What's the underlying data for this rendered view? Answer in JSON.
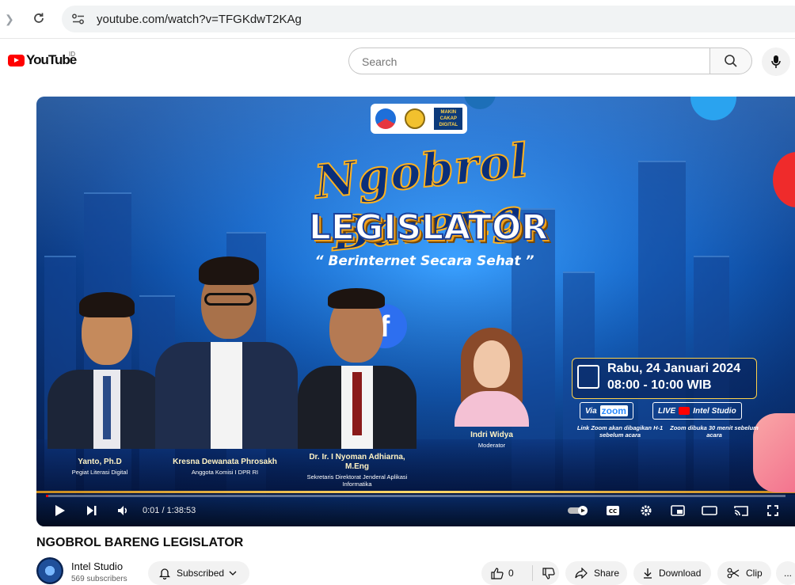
{
  "browser": {
    "url": "youtube.com/watch?v=TFGKdwT2KAg"
  },
  "masthead": {
    "logo_text": "YouTube",
    "country_code": "ID",
    "search_placeholder": "Search"
  },
  "video": {
    "thumbnail": {
      "logos": [
        "KOMINFO",
        "DPR",
        "MAKIN CAKAP DIGITAL"
      ],
      "title_script": "Ngobrol Bareng",
      "title_main": "LEGISLATOR",
      "tagline": "“ Berinternet Secara Sehat ”",
      "speakers": [
        {
          "name": "Yanto, Ph.D",
          "role": "Pegiat Literasi Digital"
        },
        {
          "name": "Kresna Dewanata Phrosakh",
          "role": "Anggota Komisi I DPR RI"
        },
        {
          "name": "Dr. Ir. I Nyoman Adhiarna, M.Eng",
          "role": "Sekretaris Direktorat Jenderal Aplikasi Informatika"
        },
        {
          "name": "Indri Widya",
          "role": "Moderator"
        }
      ],
      "date": "Rabu, 24 Januari 2024",
      "time": "08:00 - 10:00 WIB",
      "via_label": "Via",
      "zoom_label": "zoom",
      "live_label": "LIVE",
      "live_channel": "Intel Studio",
      "note_left": "Link Zoom akan dibagikan H-1 sebelum acara",
      "note_right": "Zoom dibuka 30 menit sebelum acara"
    },
    "player": {
      "time_display": "0:01 / 1:38:53",
      "progress_fraction": 0.0001
    },
    "title": "NGOBROL BARENG LEGISLATOR",
    "channel": {
      "name": "Intel Studio",
      "subscribers": "569 subscribers",
      "subscribed_label": "Subscribed"
    },
    "actions": {
      "like_count": "0",
      "share_label": "Share",
      "download_label": "Download",
      "clip_label": "Clip",
      "more_label": "..."
    }
  },
  "colors": {
    "brand_red": "#ff0000",
    "accent_gold": "#ffd24a",
    "thumb_blue": "#1667c9"
  }
}
